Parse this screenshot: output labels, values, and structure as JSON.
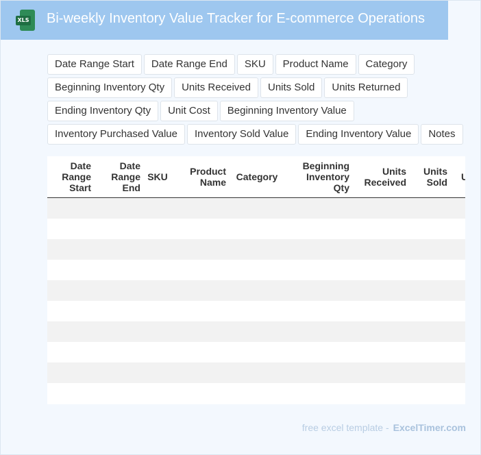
{
  "header": {
    "title": "Bi-weekly Inventory Value Tracker for E-commerce Operations",
    "icon_label": "XLS"
  },
  "fields": [
    "Date Range Start",
    "Date Range End",
    "SKU",
    "Product Name",
    "Category",
    "Beginning Inventory Qty",
    "Units Received",
    "Units Sold",
    "Units Returned",
    "Ending Inventory Qty",
    "Unit Cost",
    "Beginning Inventory Value",
    "Inventory Purchased Value",
    "Inventory Sold Value",
    "Ending Inventory Value",
    "Notes"
  ],
  "table": {
    "headers": [
      "Date Range Start",
      "Date Range End",
      "SKU",
      "Product Name",
      "Category",
      "Beginning Inventory Qty",
      "Units Received",
      "Units Sold",
      "Units Returned"
    ],
    "row_count": 10
  },
  "footer": {
    "text": "free excel template -",
    "brand": "ExcelTimer.com"
  },
  "colors": {
    "header_bg": "#9ec7ef",
    "page_bg": "#f3f8fe",
    "stripe": "#f2f2f2",
    "icon_green": "#2e8b57"
  }
}
